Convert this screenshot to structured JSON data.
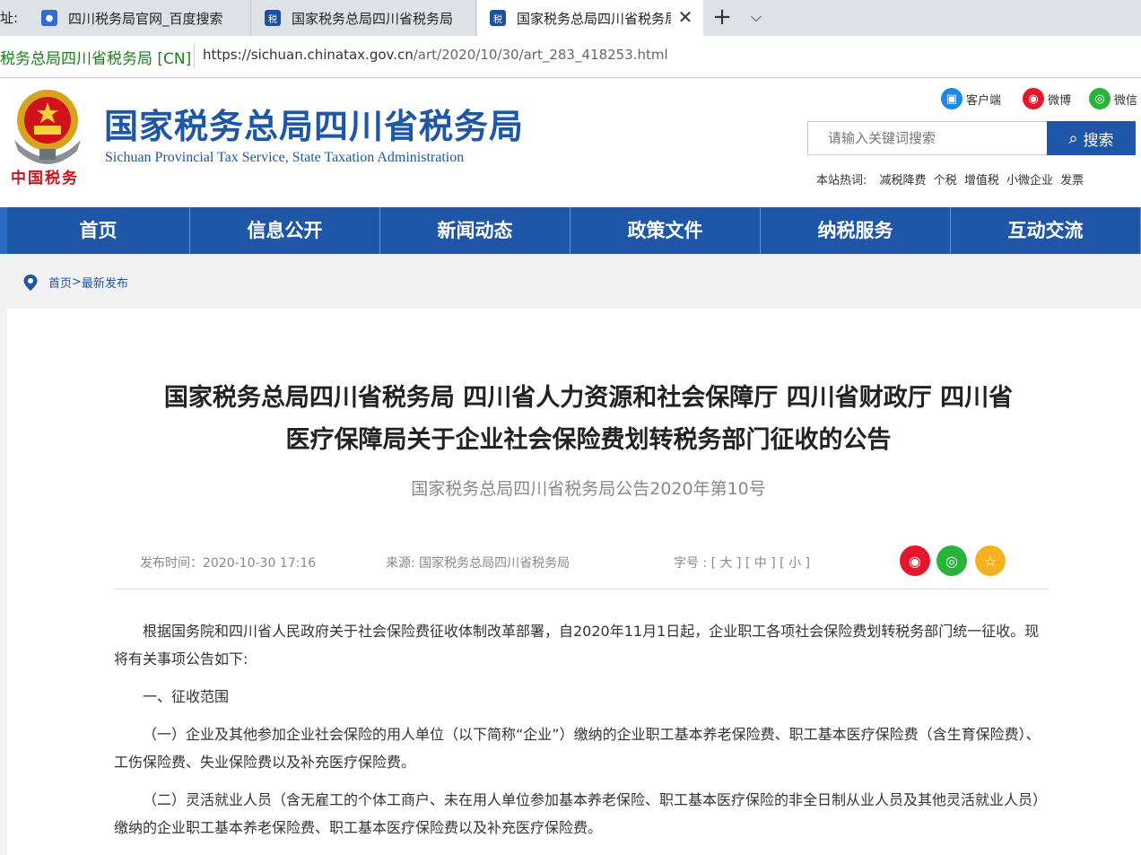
{
  "browser": {
    "address_label": "址:",
    "tabs": [
      {
        "title": "四川税务局官网_百度搜索",
        "icon": "baidu-paw-icon"
      },
      {
        "title": "国家税务总局四川省税务局",
        "icon": "tax-bureau-icon"
      },
      {
        "title": "国家税务总局四川省税务局",
        "icon": "tax-bureau-icon"
      }
    ],
    "close_glyph": "✕",
    "newtab_glyph": "+",
    "menu_glyph": "⌵",
    "site_identity": "税务总局四川省税务局 [CN]",
    "url_host": "https://sichuan.chinatax.gov.cn",
    "url_path": "/art/2020/10/30/art_283_418253.html"
  },
  "header": {
    "emblem_text": "中国税务",
    "title": "国家税务总局四川省税务局",
    "subtitle": "Sichuan Provincial Tax Service, State Taxation Administration",
    "social": [
      {
        "label": "客户端",
        "icon": "mobile-client-icon",
        "color": "#1e88e5"
      },
      {
        "label": "微博",
        "icon": "weibo-icon",
        "color": "#e6162d"
      },
      {
        "label": "微信",
        "icon": "wechat-icon",
        "color": "#28b33a"
      }
    ],
    "search": {
      "placeholder": "请输入关键词搜索",
      "button_label": "搜索"
    },
    "hotwords_label": "本站热词:",
    "hotwords": [
      "减税降费",
      "个税",
      "增值税",
      "小微企业",
      "发票"
    ]
  },
  "nav": [
    "首页",
    "信息公开",
    "新闻动态",
    "政策文件",
    "纳税服务",
    "互动交流"
  ],
  "breadcrumb": {
    "home": "首页",
    "separator": ">",
    "current": "最新发布"
  },
  "article": {
    "title_line1": "国家税务总局四川省税务局 四川省人力资源和社会保障厅 四川省财政厅 四川省",
    "title_line2": "医疗保障局关于企业社会保险费划转税务部门征收的公告",
    "doc_number": "国家税务总局四川省税务局公告2020年第10号",
    "publish_time": "发布时间：2020-10-30 17:16",
    "source": "来源:  国家税务总局四川省税务局",
    "font_size_label": "字号 : [ 大 ] [ 中 ] [ 小 ]",
    "share_buttons": [
      {
        "name": "weibo",
        "color": "#e6162d"
      },
      {
        "name": "wechat",
        "color": "#28b33a"
      },
      {
        "name": "favorite",
        "color": "#f5b21e"
      }
    ],
    "paragraphs": [
      "根据国务院和四川省人民政府关于社会保险费征收体制改革部署，自2020年11月1日起，企业职工各项社会保险费划转税务部门统一征收。现将有关事项公告如下:",
      "一、征收范围",
      "（一）企业及其他参加企业社会保险的用人单位（以下简称“企业”）缴纳的企业职工基本养老保险费、职工基本医疗保险费（含生育保险费）、工伤保险费、失业保险费以及补充医疗保险费。",
      "（二）灵活就业人员（含无雇工的个体工商户、未在用人单位参加基本养老保险、职工基本医疗保险的非全日制从业人员及其他灵活就业人员）缴纳的企业职工基本养老保险费、职工基本医疗保险费以及补充医疗保险费。"
    ]
  }
}
